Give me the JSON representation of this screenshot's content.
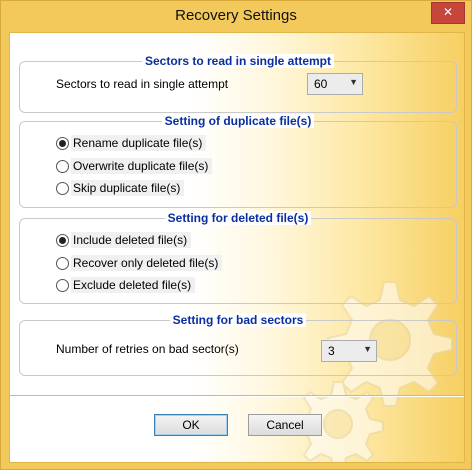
{
  "window": {
    "title": "Recovery Settings",
    "close_glyph": "✕"
  },
  "sectors_group": {
    "legend": "Sectors to read in single attempt",
    "label": "Sectors to read in single attempt",
    "selected": "60"
  },
  "duplicate_group": {
    "legend": "Setting of duplicate file(s)",
    "options": [
      {
        "label": "Rename duplicate file(s)",
        "checked": true
      },
      {
        "label": "Overwrite duplicate file(s)",
        "checked": false
      },
      {
        "label": "Skip duplicate file(s)",
        "checked": false
      }
    ]
  },
  "deleted_group": {
    "legend": "Setting for deleted file(s)",
    "options": [
      {
        "label": "Include deleted file(s)",
        "checked": true
      },
      {
        "label": "Recover only deleted file(s)",
        "checked": false
      },
      {
        "label": "Exclude deleted file(s)",
        "checked": false
      }
    ]
  },
  "bad_sectors_group": {
    "legend": "Setting for bad sectors",
    "label": "Number of retries on bad sector(s)",
    "selected": "3"
  },
  "buttons": {
    "ok": "OK",
    "cancel": "Cancel"
  },
  "colors": {
    "legend_text": "#0a2e9e",
    "accent_yellow": "#f3c95b",
    "close_red": "#c7463b"
  }
}
